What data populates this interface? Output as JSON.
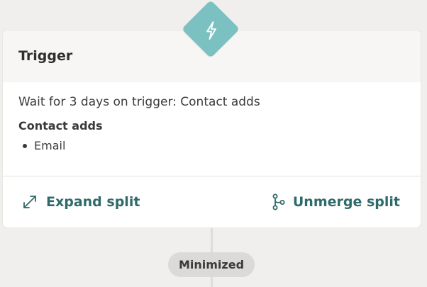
{
  "trigger": {
    "icon": "lightning-bolt-icon",
    "title": "Trigger",
    "description": "Wait for 3 days on trigger: Contact adds",
    "section_label": "Contact adds",
    "items": [
      "Email"
    ]
  },
  "actions": {
    "expand": {
      "label": "Expand split",
      "icon": "expand-arrows-icon"
    },
    "unmerge": {
      "label": "Unmerge split",
      "icon": "branch-icon"
    }
  },
  "status": {
    "minimized_label": "Minimized"
  },
  "colors": {
    "background": "#f0efed",
    "card": "#ffffff",
    "header": "#f7f6f4",
    "accent_teal": "#7cc1c1",
    "action_text": "#2f6a6a",
    "pill": "#dcdad6"
  }
}
